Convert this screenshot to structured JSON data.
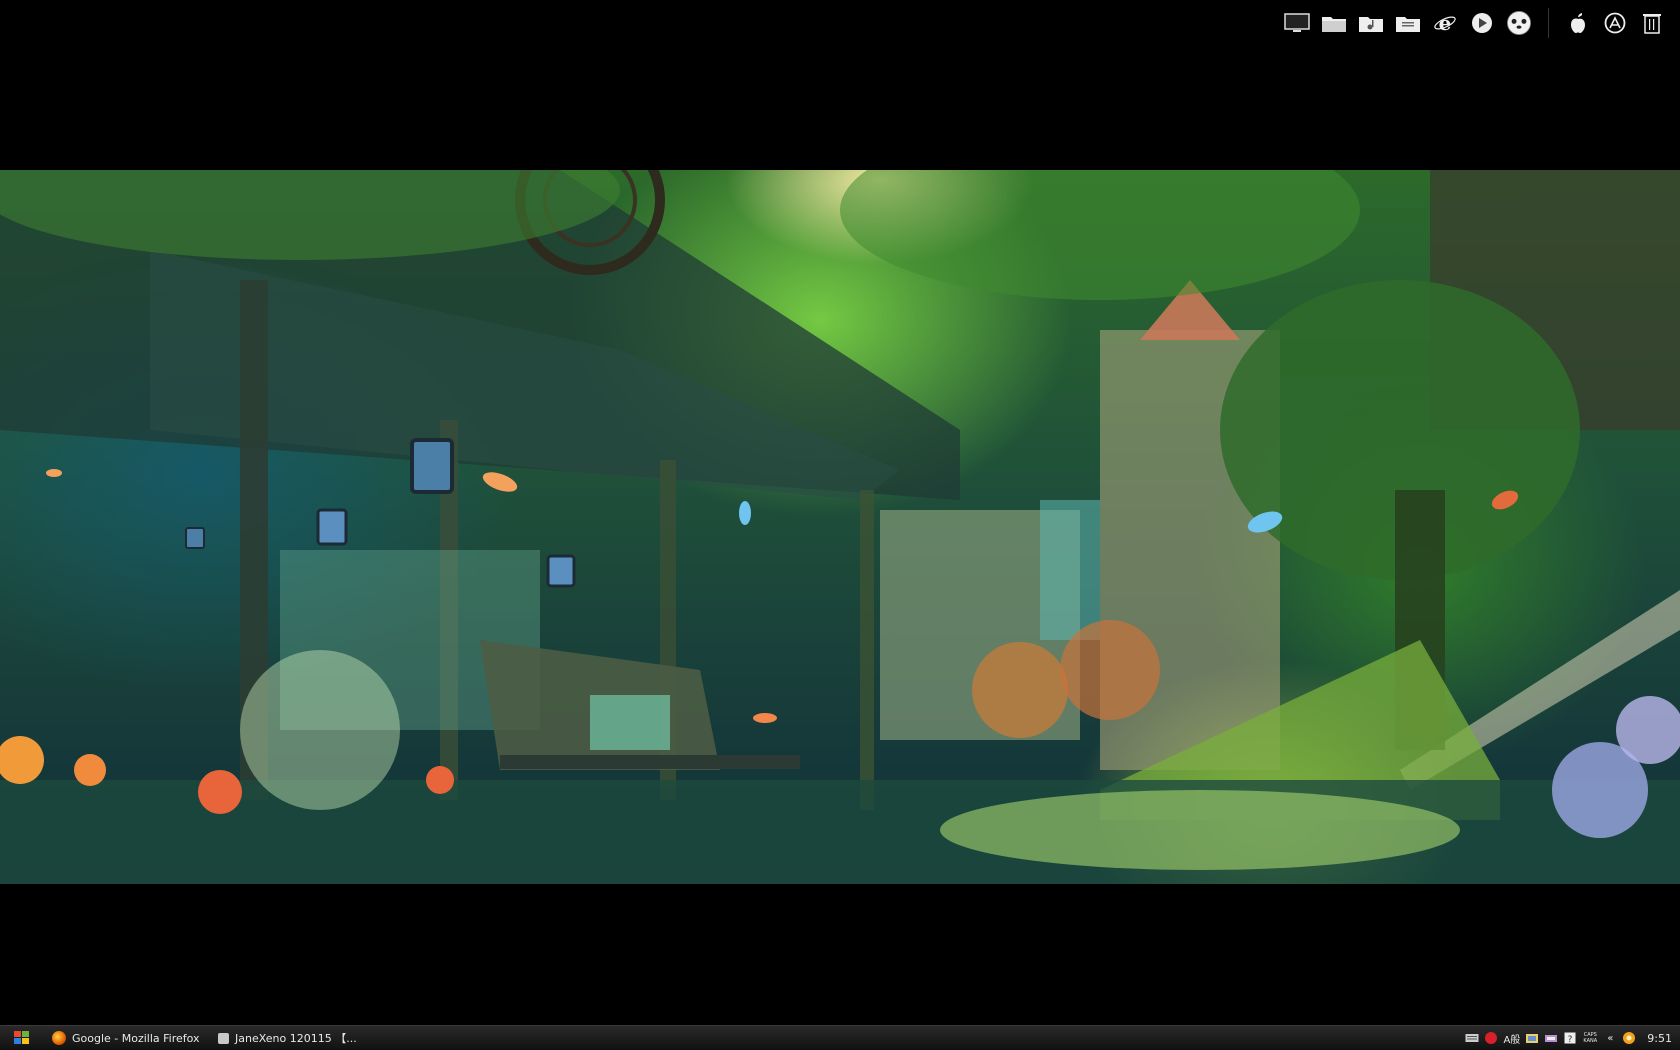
{
  "dock": {
    "icons": [
      "monitor-icon",
      "folder-icon",
      "music-folder-icon",
      "documents-folder-icon",
      "internet-explorer-icon",
      "media-player-icon",
      "panda-avatar-icon",
      "apple-icon",
      "app-store-icon",
      "trash-icon"
    ]
  },
  "taskbar": {
    "tasks": [
      {
        "label": "Google - Mozilla Firefox",
        "icon": "firefox-icon"
      },
      {
        "label": "JaneXeno 120115 【...",
        "icon": "janexeno-icon"
      }
    ],
    "tray": {
      "ime_label": "A般",
      "caps_label": "CAPS KANA",
      "expand_label": "«",
      "clock": "9:51"
    },
    "colors": {
      "firefox": "#e66000",
      "janexeno": "#c9c9c9"
    }
  }
}
